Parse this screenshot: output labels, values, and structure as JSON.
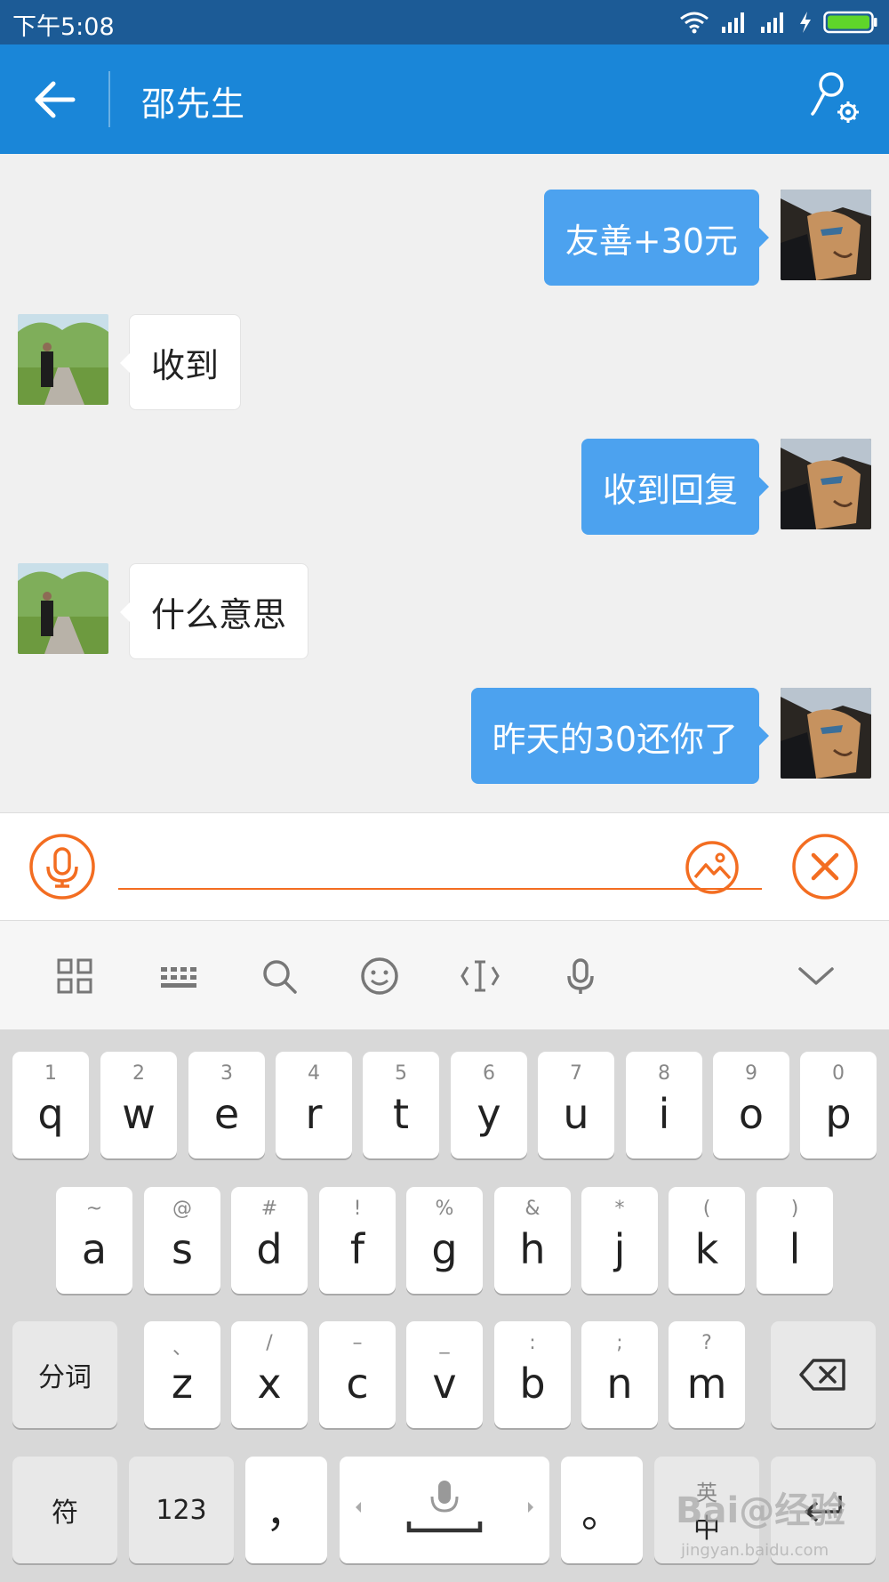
{
  "status_bar": {
    "time": "下午5:08"
  },
  "header": {
    "title": "邵先生"
  },
  "messages": [
    {
      "side": "out",
      "text": "友善+30元"
    },
    {
      "side": "in",
      "text": "收到"
    },
    {
      "side": "out",
      "text": "收到回复"
    },
    {
      "side": "in",
      "text": "什么意思"
    },
    {
      "side": "out",
      "text": "昨天的30还你了"
    }
  ],
  "input": {
    "value": "",
    "placeholder": ""
  },
  "ime_toolbar": [
    "grid-icon",
    "keyboard-icon",
    "search-icon",
    "emoji-icon",
    "cursor-icon",
    "mic-icon",
    "chevron-down-icon"
  ],
  "keyboard": {
    "row1": [
      {
        "main": "q",
        "sub": "1"
      },
      {
        "main": "w",
        "sub": "2"
      },
      {
        "main": "e",
        "sub": "3"
      },
      {
        "main": "r",
        "sub": "4"
      },
      {
        "main": "t",
        "sub": "5"
      },
      {
        "main": "y",
        "sub": "6"
      },
      {
        "main": "u",
        "sub": "7"
      },
      {
        "main": "i",
        "sub": "8"
      },
      {
        "main": "o",
        "sub": "9"
      },
      {
        "main": "p",
        "sub": "0"
      }
    ],
    "row2": [
      {
        "main": "a",
        "sub": "~"
      },
      {
        "main": "s",
        "sub": "@"
      },
      {
        "main": "d",
        "sub": "#"
      },
      {
        "main": "f",
        "sub": "!"
      },
      {
        "main": "g",
        "sub": "%"
      },
      {
        "main": "h",
        "sub": "&"
      },
      {
        "main": "j",
        "sub": "*"
      },
      {
        "main": "k",
        "sub": "("
      },
      {
        "main": "l",
        "sub": ")"
      }
    ],
    "row3": [
      {
        "main": "z",
        "sub": "、"
      },
      {
        "main": "x",
        "sub": "/"
      },
      {
        "main": "c",
        "sub": "–"
      },
      {
        "main": "v",
        "sub": "_"
      },
      {
        "main": "b",
        "sub": ":"
      },
      {
        "main": "n",
        "sub": ";"
      },
      {
        "main": "m",
        "sub": "?"
      }
    ],
    "fenci_label": "分词",
    "symbol_label": "符",
    "num_label": "123",
    "comma_label": "，",
    "period_label": "。",
    "lang_top": "英",
    "lang_bottom": "中"
  },
  "watermark": {
    "brand": "Bai@经验",
    "url": "jingyan.baidu.com"
  },
  "colors": {
    "status": "#1c5b96",
    "header": "#1a86d8",
    "bubble_out": "#4ca2ef",
    "accent": "#f36d21"
  }
}
